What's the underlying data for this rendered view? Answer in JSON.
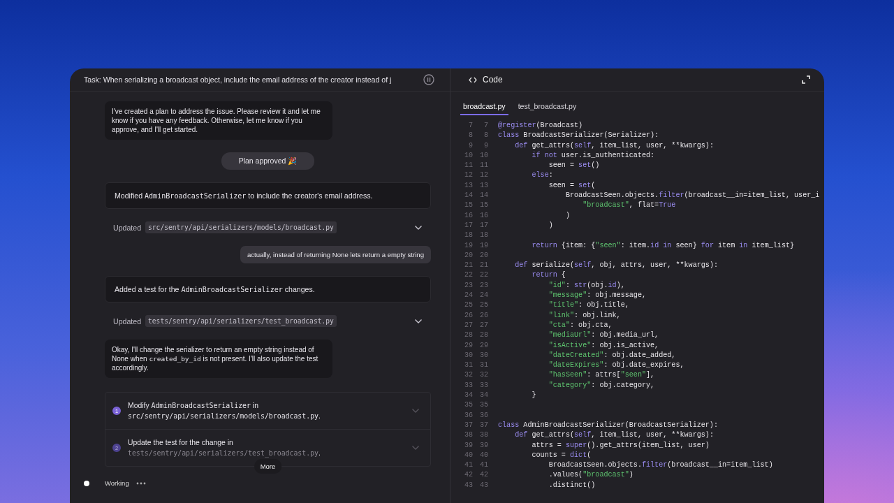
{
  "task_panel": {
    "title": "Task: When serializing a broadcast object, include the email address of the creator instead of j",
    "messages": [
      {
        "kind": "agent",
        "parts": [
          {
            "kind": "text",
            "text": "I've created a plan to address the issue. Please review it and let me know if you have any feedback. Otherwise, let me know if you approve, and I'll get started."
          }
        ]
      },
      {
        "kind": "status",
        "text": "Plan approved 🎉"
      },
      {
        "kind": "summary",
        "parts": [
          {
            "kind": "text",
            "text": "Modified "
          },
          {
            "kind": "code",
            "text": "AdminBroadcastSerializer"
          },
          {
            "kind": "text",
            "text": " to include the creator's email address."
          }
        ]
      },
      {
        "kind": "update",
        "label": "Updated",
        "path": "src/sentry/api/serializers/models/broadcast.py"
      },
      {
        "kind": "user",
        "text": "actually, instead of returning None lets return a empty string"
      },
      {
        "kind": "summary",
        "parts": [
          {
            "kind": "text",
            "text": "Added a test for the "
          },
          {
            "kind": "code",
            "text": "AdminBroadcastSerializer"
          },
          {
            "kind": "text",
            "text": " changes."
          }
        ]
      },
      {
        "kind": "update",
        "label": "Updated",
        "path": "tests/sentry/api/serializers/test_broadcast.py"
      },
      {
        "kind": "agent",
        "parts": [
          {
            "kind": "text",
            "text": "Okay, I'll change the serializer to return an empty string instead of None when "
          },
          {
            "kind": "code",
            "text": "created_by_id"
          },
          {
            "kind": "text",
            "text": " is not present. I'll also update the test accordingly."
          }
        ]
      }
    ],
    "plan": {
      "steps": [
        {
          "number": "1",
          "active": true,
          "parts": [
            {
              "kind": "text",
              "text": "Modify "
            },
            {
              "kind": "code",
              "text": "AdminBroadcastSerializer"
            },
            {
              "kind": "text",
              "text": " in "
            },
            {
              "kind": "path",
              "text": "src/sentry/api/serializers/models/broadcast.py"
            },
            {
              "kind": "text",
              "text": "."
            }
          ]
        },
        {
          "number": "2",
          "active": false,
          "parts": [
            {
              "kind": "text",
              "text": "Update the test for the change in "
            },
            {
              "kind": "path",
              "text": "tests/sentry/api/serializers/test_broadcast.py"
            },
            {
              "kind": "text",
              "text": "."
            }
          ]
        }
      ],
      "more_label": "More"
    },
    "working": {
      "label": "Working"
    }
  },
  "code_panel": {
    "title": "Code",
    "tabs": [
      {
        "label": "broadcast.py",
        "selected": true
      },
      {
        "label": "test_broadcast.py",
        "selected": false
      }
    ],
    "lines": [
      {
        "old": "7",
        "new": "7",
        "tokens": [
          {
            "kind": "kw",
            "text": "@register"
          },
          {
            "kind": "plain",
            "text": "(Broadcast)"
          }
        ]
      },
      {
        "old": "8",
        "new": "8",
        "tokens": [
          {
            "kind": "kw",
            "text": "class"
          },
          {
            "kind": "plain",
            "text": " BroadcastSerializer(Serializer):"
          }
        ]
      },
      {
        "old": "9",
        "new": "9",
        "tokens": [
          {
            "kind": "kw",
            "text": "    def"
          },
          {
            "kind": "plain",
            "text": " get_attrs("
          },
          {
            "kind": "kw",
            "text": "self"
          },
          {
            "kind": "plain",
            "text": ", item_list, user, **kwargs):"
          }
        ]
      },
      {
        "old": "10",
        "new": "10",
        "tokens": [
          {
            "kind": "kw",
            "text": "        if not"
          },
          {
            "kind": "plain",
            "text": " user.is_authenticated:"
          }
        ]
      },
      {
        "old": "11",
        "new": "11",
        "tokens": [
          {
            "kind": "plain",
            "text": "            seen = "
          },
          {
            "kind": "kw",
            "text": "set"
          },
          {
            "kind": "plain",
            "text": "()"
          }
        ]
      },
      {
        "old": "12",
        "new": "12",
        "tokens": [
          {
            "kind": "kw",
            "text": "        else"
          },
          {
            "kind": "plain",
            "text": ":"
          }
        ]
      },
      {
        "old": "13",
        "new": "13",
        "tokens": [
          {
            "kind": "plain",
            "text": "            seen = "
          },
          {
            "kind": "kw",
            "text": "set"
          },
          {
            "kind": "plain",
            "text": "("
          }
        ]
      },
      {
        "old": "14",
        "new": "14",
        "tokens": [
          {
            "kind": "plain",
            "text": "                BroadcastSeen.objects."
          },
          {
            "kind": "kw",
            "text": "filter"
          },
          {
            "kind": "plain",
            "text": "(broadcast__in=item_list, user_i"
          }
        ]
      },
      {
        "old": "15",
        "new": "15",
        "tokens": [
          {
            "kind": "str",
            "text": "                    \"broadcast\""
          },
          {
            "kind": "plain",
            "text": ", flat="
          },
          {
            "kind": "kw",
            "text": "True"
          }
        ]
      },
      {
        "old": "16",
        "new": "16",
        "tokens": [
          {
            "kind": "plain",
            "text": "                )"
          }
        ]
      },
      {
        "old": "17",
        "new": "17",
        "tokens": [
          {
            "kind": "plain",
            "text": "            )"
          }
        ]
      },
      {
        "old": "18",
        "new": "18"
      },
      {
        "old": "19",
        "new": "19",
        "tokens": [
          {
            "kind": "kw",
            "text": "        return"
          },
          {
            "kind": "plain",
            "text": " {item: {"
          },
          {
            "kind": "str",
            "text": "\"seen\""
          },
          {
            "kind": "plain",
            "text": ": item."
          },
          {
            "kind": "kw",
            "text": "id in"
          },
          {
            "kind": "plain",
            "text": " seen} "
          },
          {
            "kind": "kw",
            "text": "for"
          },
          {
            "kind": "plain",
            "text": " item "
          },
          {
            "kind": "kw",
            "text": "in"
          },
          {
            "kind": "plain",
            "text": " item_list}"
          }
        ]
      },
      {
        "old": "20",
        "new": "20"
      },
      {
        "old": "21",
        "new": "21",
        "tokens": [
          {
            "kind": "kw",
            "text": "    def"
          },
          {
            "kind": "plain",
            "text": " serialize("
          },
          {
            "kind": "kw",
            "text": "self"
          },
          {
            "kind": "plain",
            "text": ", obj, attrs, user, **kwargs):"
          }
        ]
      },
      {
        "old": "22",
        "new": "22",
        "tokens": [
          {
            "kind": "kw",
            "text": "        return"
          },
          {
            "kind": "plain",
            "text": " {"
          }
        ]
      },
      {
        "old": "23",
        "new": "23",
        "tokens": [
          {
            "kind": "str",
            "text": "            \"id\""
          },
          {
            "kind": "plain",
            "text": ": "
          },
          {
            "kind": "kw",
            "text": "str"
          },
          {
            "kind": "plain",
            "text": "(obj."
          },
          {
            "kind": "kw",
            "text": "id"
          },
          {
            "kind": "plain",
            "text": "),"
          }
        ]
      },
      {
        "old": "24",
        "new": "24",
        "tokens": [
          {
            "kind": "str",
            "text": "            \"message\""
          },
          {
            "kind": "plain",
            "text": ": obj.message,"
          }
        ]
      },
      {
        "old": "25",
        "new": "25",
        "tokens": [
          {
            "kind": "str",
            "text": "            \"title\""
          },
          {
            "kind": "plain",
            "text": ": obj.title,"
          }
        ]
      },
      {
        "old": "26",
        "new": "26",
        "tokens": [
          {
            "kind": "str",
            "text": "            \"link\""
          },
          {
            "kind": "plain",
            "text": ": obj.link,"
          }
        ]
      },
      {
        "old": "27",
        "new": "27",
        "tokens": [
          {
            "kind": "str",
            "text": "            \"cta\""
          },
          {
            "kind": "plain",
            "text": ": obj.cta,"
          }
        ]
      },
      {
        "old": "28",
        "new": "28",
        "tokens": [
          {
            "kind": "str",
            "text": "            \"mediaUrl\""
          },
          {
            "kind": "plain",
            "text": ": obj.media_url,"
          }
        ]
      },
      {
        "old": "29",
        "new": "29",
        "tokens": [
          {
            "kind": "str",
            "text": "            \"isActive\""
          },
          {
            "kind": "plain",
            "text": ": obj.is_active,"
          }
        ]
      },
      {
        "old": "30",
        "new": "30",
        "tokens": [
          {
            "kind": "str",
            "text": "            \"dateCreated\""
          },
          {
            "kind": "plain",
            "text": ": obj.date_added,"
          }
        ]
      },
      {
        "old": "31",
        "new": "31",
        "tokens": [
          {
            "kind": "str",
            "text": "            \"dateExpires\""
          },
          {
            "kind": "plain",
            "text": ": obj.date_expires,"
          }
        ]
      },
      {
        "old": "32",
        "new": "32",
        "tokens": [
          {
            "kind": "str",
            "text": "            \"hasSeen\""
          },
          {
            "kind": "plain",
            "text": ": attrs["
          },
          {
            "kind": "str",
            "text": "\"seen\""
          },
          {
            "kind": "plain",
            "text": "],"
          }
        ]
      },
      {
        "old": "33",
        "new": "33",
        "tokens": [
          {
            "kind": "str",
            "text": "            \"category\""
          },
          {
            "kind": "plain",
            "text": ": obj.category,"
          }
        ]
      },
      {
        "old": "34",
        "new": "34",
        "tokens": [
          {
            "kind": "plain",
            "text": "        }"
          }
        ]
      },
      {
        "old": "35",
        "new": "35"
      },
      {
        "old": "36",
        "new": "36"
      },
      {
        "old": "37",
        "new": "37",
        "tokens": [
          {
            "kind": "kw",
            "text": "class"
          },
          {
            "kind": "plain",
            "text": " AdminBroadcastSerializer(BroadcastSerializer):"
          }
        ]
      },
      {
        "old": "38",
        "new": "38",
        "tokens": [
          {
            "kind": "kw",
            "text": "    def"
          },
          {
            "kind": "plain",
            "text": " get_attrs("
          },
          {
            "kind": "kw",
            "text": "self"
          },
          {
            "kind": "plain",
            "text": ", item_list, user, **kwargs):"
          }
        ]
      },
      {
        "old": "39",
        "new": "39",
        "tokens": [
          {
            "kind": "plain",
            "text": "        attrs = "
          },
          {
            "kind": "kw",
            "text": "super"
          },
          {
            "kind": "plain",
            "text": "().get_attrs(item_list, user)"
          }
        ]
      },
      {
        "old": "40",
        "new": "40",
        "tokens": [
          {
            "kind": "plain",
            "text": "        counts = "
          },
          {
            "kind": "kw",
            "text": "dict"
          },
          {
            "kind": "plain",
            "text": "("
          }
        ]
      },
      {
        "old": "41",
        "new": "41",
        "tokens": [
          {
            "kind": "plain",
            "text": "            BroadcastSeen.objects."
          },
          {
            "kind": "kw",
            "text": "filter"
          },
          {
            "kind": "plain",
            "text": "(broadcast__in=item_list)"
          }
        ]
      },
      {
        "old": "42",
        "new": "42",
        "tokens": [
          {
            "kind": "plain",
            "text": "            .values("
          },
          {
            "kind": "str",
            "text": "\"broadcast\""
          },
          {
            "kind": "plain",
            "text": ")"
          }
        ]
      },
      {
        "old": "43",
        "new": "43",
        "tokens": [
          {
            "kind": "plain",
            "text": "            .distinct()"
          }
        ]
      }
    ]
  }
}
